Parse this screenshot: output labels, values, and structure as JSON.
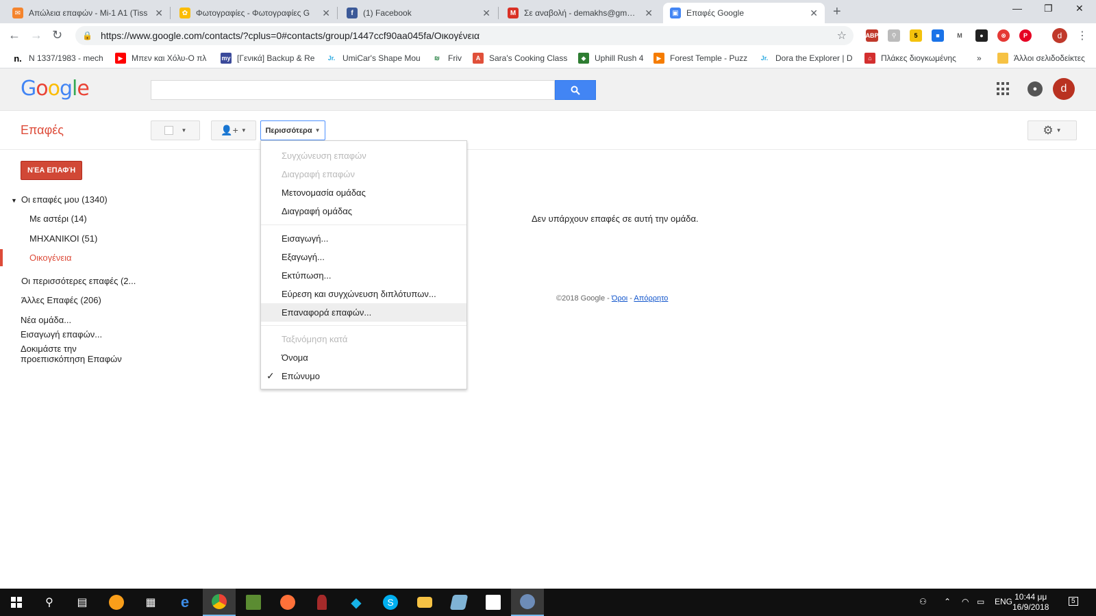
{
  "browser": {
    "tabs": [
      {
        "title": "Απώλεια επαφών - Mi-1 A1 (Tiss",
        "favicon_color": "#f4842d",
        "glyph": "✉"
      },
      {
        "title": "Φωτογραφίες - Φωτογραφίες G",
        "favicon_color": "#4285f4",
        "glyph": "✿"
      },
      {
        "title": "(1) Facebook",
        "favicon_color": "#3b5998",
        "glyph": "f"
      },
      {
        "title": "Σε αναβολή - demakhs@gmail.cc",
        "favicon_color": "#d93025",
        "glyph": "M"
      },
      {
        "title": "Επαφές Google",
        "favicon_color": "#4285f4",
        "glyph": "👤"
      }
    ],
    "new_tab": "+",
    "window_controls": {
      "minimize": "—",
      "restore": "❐",
      "close": "✕"
    },
    "nav": {
      "back": "←",
      "forward": "→",
      "reload": "↻"
    },
    "url": "https://www.google.com/contacts/?cplus=0#contacts/group/1447ccf90aa045fa/Οικογένεια",
    "bookmark_star": "☆",
    "account_initial": "d",
    "menu": "⋮",
    "bookmarks": [
      {
        "label": "N 1337/1983 - mech",
        "color": "#000000",
        "glyph": "n."
      },
      {
        "label": "Μπεν και Χόλυ-Ο πλ",
        "color": "#ff0000",
        "glyph": "▶"
      },
      {
        "label": "[Γενικά] Backup & Re",
        "color": "#3b4a9a",
        "glyph": "my"
      },
      {
        "label": "UmiCar's Shape Mou",
        "color": "#2aa9e0",
        "glyph": "Jr."
      },
      {
        "label": "Friv",
        "color": "#1c7b3a",
        "glyph": "₪"
      },
      {
        "label": "Sara's Cooking Class",
        "color": "#e0503a",
        "glyph": "A"
      },
      {
        "label": "Uphill Rush 4",
        "color": "#2e7d32",
        "glyph": "◆"
      },
      {
        "label": "Forest Temple - Puzz",
        "color": "#f57c00",
        "glyph": "▶"
      },
      {
        "label": "Dora the Explorer | D",
        "color": "#2aa9e0",
        "glyph": "Jr."
      },
      {
        "label": "Πλάκες διογκωμένης",
        "color": "#d32f2f",
        "glyph": "⌂"
      }
    ],
    "bookmarks_more": "»",
    "other_bookmarks": "Άλλοι σελιδοδείκτες"
  },
  "header": {
    "logo": "Google",
    "search_placeholder": "",
    "search_icon": "search-icon",
    "apps_icon": "apps-icon",
    "notifications_icon": "bell-icon",
    "avatar_initial": "d"
  },
  "toolbar": {
    "title": "Επαφές",
    "more_button": "Περισσότερα",
    "settings_icon": "gear-icon"
  },
  "sidebar": {
    "new_contact_button": "ΝΈΑ ΕΠΑΦΉ",
    "my_contacts": "Οι επαφές μου (1340)",
    "groups": [
      {
        "label": "Με αστέρι (14)",
        "selected": false
      },
      {
        "label": "ΜΗΧΑΝΙΚΟΙ (51)",
        "selected": false
      },
      {
        "label": "Οικογένεια",
        "selected": true
      }
    ],
    "most_contacted": "Οι περισσότερες επαφές (2...",
    "other_contacts": "Άλλες Επαφές (206)",
    "new_group": "Νέα ομάδα...",
    "import_contacts": "Εισαγωγή επαφών...",
    "try_preview_line1": "Δοκιμάστε την",
    "try_preview_line2": "προεπισκόπηση Επαφών"
  },
  "dropdown": {
    "items_group1": [
      {
        "label": "Συγχώνευση επαφών",
        "disabled": true
      },
      {
        "label": "Διαγραφή επαφών",
        "disabled": true
      },
      {
        "label": "Μετονομασία ομάδας",
        "disabled": false
      },
      {
        "label": "Διαγραφή ομάδας",
        "disabled": false
      }
    ],
    "items_group2": [
      {
        "label": "Εισαγωγή..."
      },
      {
        "label": "Εξαγωγή..."
      },
      {
        "label": "Εκτύπωση..."
      },
      {
        "label": "Εύρεση και συγχώνευση διπλότυπων..."
      },
      {
        "label": "Επαναφορά επαφών...",
        "hovered": true
      }
    ],
    "sort_header": "Ταξινόμηση κατά",
    "sort_items": [
      {
        "label": "Όνομα",
        "checked": false
      },
      {
        "label": "Επώνυμο",
        "checked": true
      }
    ],
    "checkmark": "✓"
  },
  "main": {
    "empty_message": "Δεν υπάρχουν επαφές σε αυτή την ομάδα.",
    "footer_copyright": "©2018 Google - ",
    "footer_terms": "Όροι",
    "footer_dash": " - ",
    "footer_privacy": "Απόρρητο"
  },
  "taskbar": {
    "apps": [
      "start-icon",
      "search-icon",
      "task-view-icon",
      "overwatch-icon",
      "calculator-icon",
      "edge-icon",
      "chrome-icon",
      "minecraft-icon",
      "firefox-icon",
      "app-icon",
      "kodi-icon",
      "skype-icon",
      "file-explorer-icon",
      "app-icon",
      "store-icon",
      "app-icon"
    ],
    "language": "ENG",
    "time": "10:44 μμ",
    "date": "16/9/2018",
    "notifications_count": "5"
  }
}
